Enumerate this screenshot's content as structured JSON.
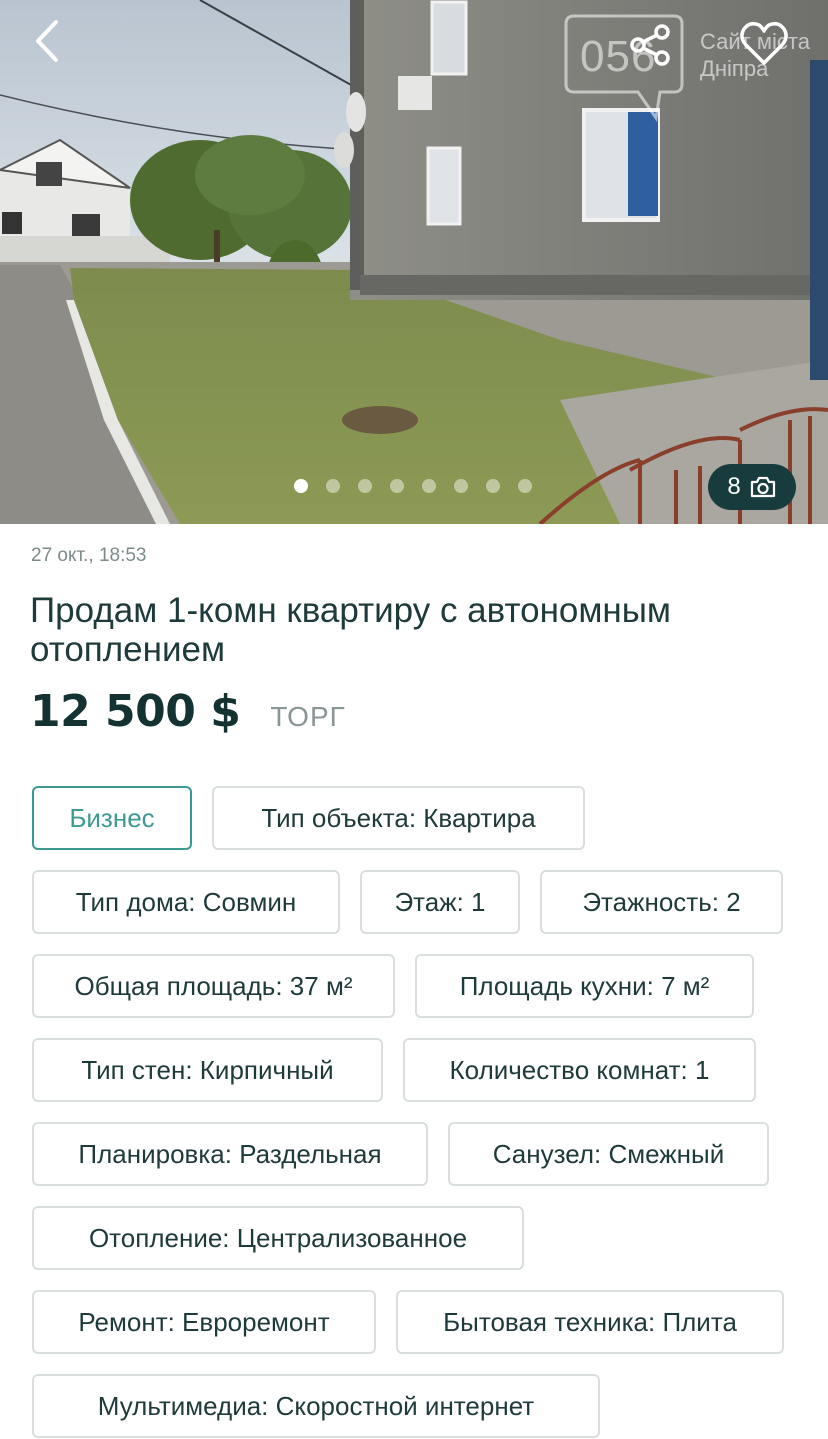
{
  "photo": {
    "watermark_number": "056",
    "watermark_text_line1": "Сайт міста",
    "watermark_text_line2": "Дніпра",
    "photo_count": "8",
    "dots_total": 8,
    "dots_active_index": 0
  },
  "listing": {
    "date": "27 окт., 18:53",
    "title": "Продам 1-комн квартиру с автономным отоплением",
    "price": "12 500 $",
    "bargain_label": "ТОРГ"
  },
  "tags": [
    "Бизнес",
    "Тип объекта: Квартира",
    "Тип дома: Совмин",
    "Этаж: 1",
    "Этажность: 2",
    "Общая площадь: 37 м²",
    "Площадь кухни: 7 м²",
    "Тип стен: Кирпичный",
    "Количество комнат: 1",
    "Планировка: Раздельная",
    "Санузел: Смежный",
    "Отопление: Централизованное",
    "Ремонт: Евроремонт",
    "Бытовая техника: Плита",
    "Мультимедиа: Скоростной интернет"
  ],
  "colors": {
    "accent": "#3d9a93",
    "badge_bg": "#183c3e",
    "text_dark": "#1f3a3a",
    "text_muted": "#7d8a8a"
  },
  "icons": [
    "back-arrow-icon",
    "share-icon",
    "heart-icon",
    "camera-icon"
  ]
}
